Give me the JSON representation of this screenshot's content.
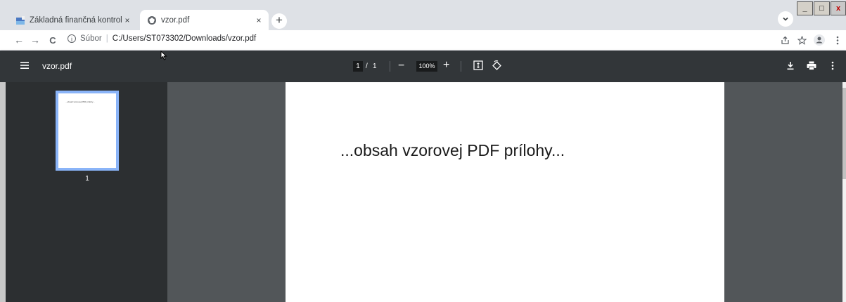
{
  "browser": {
    "tabs": [
      {
        "title": "Základná finančná kontrola",
        "favicon": "chart-icon",
        "active": false
      },
      {
        "title": "vzor.pdf",
        "favicon": "globe-icon",
        "active": true
      }
    ],
    "new_tab_label": "+",
    "close_glyph": "×",
    "window_controls": {
      "minimize": "_",
      "maximize": "□",
      "close": "x"
    }
  },
  "toolbar": {
    "back_icon": "←",
    "forward_icon": "→",
    "reload_icon": "C",
    "info_glyph": "i",
    "scheme_label": "Súbor",
    "separator": "|",
    "url": "C:/Users/ST073302/Downloads/vzor.pdf"
  },
  "pdf_viewer": {
    "file_title": "vzor.pdf",
    "current_page": "1",
    "page_separator": "/",
    "page_count": "1",
    "zoom": "100%",
    "zoom_out_glyph": "−",
    "zoom_in_glyph": "+"
  },
  "thumbnail": {
    "page_number": "1",
    "preview_text": "...obsah vzorovej PDF prílohy..."
  },
  "document": {
    "content": "...obsah vzorovej PDF prílohy..."
  },
  "colors": {
    "tabstrip": "#dee1e6",
    "pdf_toolbar": "#323639",
    "sidebar": "#2c2f31",
    "viewer_background": "#525659",
    "thumbnail_highlight": "#8ab4f8"
  }
}
